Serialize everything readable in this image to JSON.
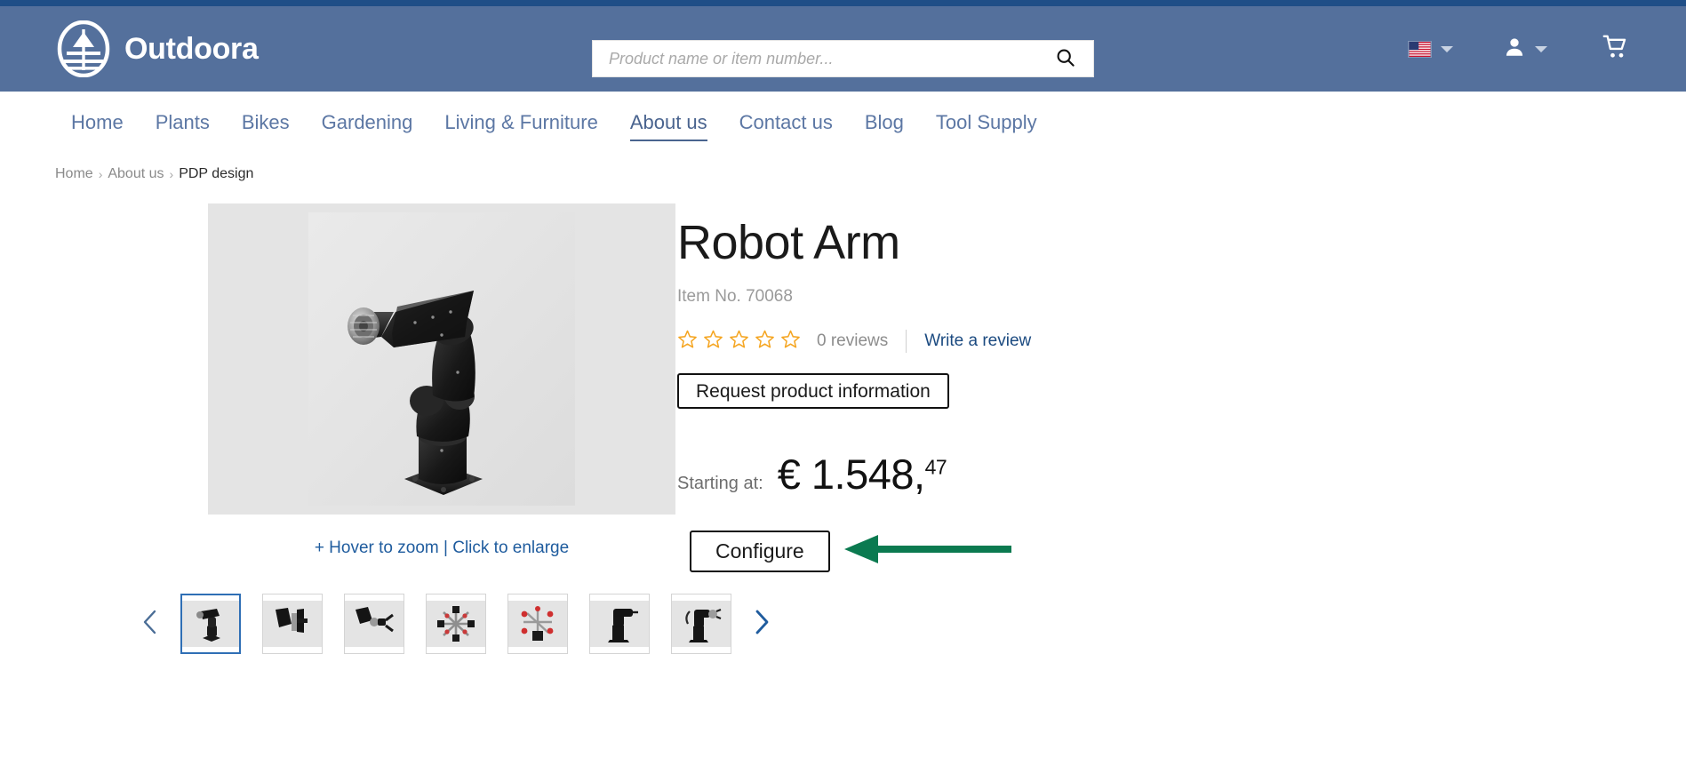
{
  "theme": {
    "top_strip_color": "#1f4e87",
    "header_bg": "#54709c",
    "nav_link_color": "#5c77a4",
    "link_blue": "#1f5c9e",
    "star_color": "#f5a623",
    "annotation_arrow_color": "#0b7a50",
    "thumb_selected_border": "#2f6fb5"
  },
  "header": {
    "brand_name": "Outdoora",
    "logo_icon": "tree-in-oval-logo",
    "search": {
      "placeholder": "Product name or item number...",
      "value": "",
      "button_icon": "search-icon"
    },
    "language": {
      "icon": "us-flag-icon",
      "caret_icon": "chevron-down-icon",
      "label": ""
    },
    "account": {
      "icon": "person-icon",
      "caret_icon": "chevron-down-icon",
      "label": ""
    },
    "cart": {
      "icon": "shopping-cart-icon",
      "label": ""
    }
  },
  "nav": {
    "items": [
      {
        "label": "Home",
        "active": false
      },
      {
        "label": "Plants",
        "active": false
      },
      {
        "label": "Bikes",
        "active": false
      },
      {
        "label": "Gardening",
        "active": false
      },
      {
        "label": "Living & Furniture",
        "active": false
      },
      {
        "label": "About us",
        "active": true
      },
      {
        "label": "Contact us",
        "active": false
      },
      {
        "label": "Blog",
        "active": false
      },
      {
        "label": "Tool Supply",
        "active": false
      }
    ]
  },
  "breadcrumb": {
    "separator": "›",
    "items": [
      {
        "label": "Home",
        "current": false
      },
      {
        "label": "About us",
        "current": false
      },
      {
        "label": "PDP design",
        "current": true
      }
    ]
  },
  "gallery": {
    "main_image_alt": "robot-arm-product-photo",
    "zoom_hint": "+ Hover to zoom | Click to enlarge",
    "prev_icon": "chevron-left-icon",
    "next_icon": "chevron-right-icon",
    "thumbnails": [
      {
        "alt": "robot-arm-angled-view",
        "selected": true
      },
      {
        "alt": "robot-arm-gripper-open",
        "selected": false
      },
      {
        "alt": "robot-arm-gripper-detail",
        "selected": false
      },
      {
        "alt": "robot-arm-multi-tool-rig",
        "selected": false
      },
      {
        "alt": "robot-arm-red-tooling-rig",
        "selected": false
      },
      {
        "alt": "robot-arm-side-profile",
        "selected": false
      },
      {
        "alt": "robot-arm-with-end-effector",
        "selected": false
      }
    ]
  },
  "product": {
    "title": "Robot Arm",
    "item_no_label": "Item No. 70068",
    "rating": {
      "stars_total": 5,
      "stars_filled": 0,
      "reviews_text": "0 reviews",
      "write_review_label": "Write a review"
    },
    "request_info_label": "Request product information",
    "price": {
      "prefix_label": "Starting at:",
      "currency": "€",
      "amount": "1.548,",
      "cents": "47"
    },
    "configure_label": "Configure"
  },
  "annotation": {
    "arrow_direction": "left",
    "points_to": "configure-button"
  }
}
